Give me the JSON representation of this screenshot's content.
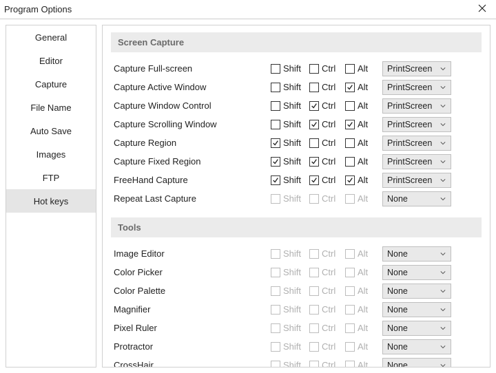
{
  "window": {
    "title": "Program Options"
  },
  "sidebar": {
    "items": [
      {
        "label": "General",
        "selected": false
      },
      {
        "label": "Editor",
        "selected": false
      },
      {
        "label": "Capture",
        "selected": false
      },
      {
        "label": "File Name",
        "selected": false
      },
      {
        "label": "Auto Save",
        "selected": false
      },
      {
        "label": "Images",
        "selected": false
      },
      {
        "label": "FTP",
        "selected": false
      },
      {
        "label": "Hot keys",
        "selected": true
      }
    ]
  },
  "labels": {
    "shift": "Shift",
    "ctrl": "Ctrl",
    "alt": "Alt"
  },
  "sections": [
    {
      "title": "Screen Capture",
      "rows": [
        {
          "label": "Capture Full-screen",
          "shift": false,
          "ctrl": false,
          "alt": false,
          "key": "PrintScreen",
          "enabled": true
        },
        {
          "label": "Capture Active Window",
          "shift": false,
          "ctrl": false,
          "alt": true,
          "key": "PrintScreen",
          "enabled": true
        },
        {
          "label": "Capture Window Control",
          "shift": false,
          "ctrl": true,
          "alt": false,
          "key": "PrintScreen",
          "enabled": true
        },
        {
          "label": "Capture Scrolling Window",
          "shift": false,
          "ctrl": true,
          "alt": true,
          "key": "PrintScreen",
          "enabled": true
        },
        {
          "label": "Capture Region",
          "shift": true,
          "ctrl": false,
          "alt": false,
          "key": "PrintScreen",
          "enabled": true
        },
        {
          "label": "Capture Fixed Region",
          "shift": true,
          "ctrl": true,
          "alt": false,
          "key": "PrintScreen",
          "enabled": true
        },
        {
          "label": "FreeHand Capture",
          "shift": true,
          "ctrl": true,
          "alt": true,
          "key": "PrintScreen",
          "enabled": true
        },
        {
          "label": "Repeat Last Capture",
          "shift": false,
          "ctrl": false,
          "alt": false,
          "key": "None",
          "enabled": false
        }
      ]
    },
    {
      "title": "Tools",
      "rows": [
        {
          "label": "Image Editor",
          "shift": false,
          "ctrl": false,
          "alt": false,
          "key": "None",
          "enabled": false
        },
        {
          "label": "Color Picker",
          "shift": false,
          "ctrl": false,
          "alt": false,
          "key": "None",
          "enabled": false
        },
        {
          "label": "Color Palette",
          "shift": false,
          "ctrl": false,
          "alt": false,
          "key": "None",
          "enabled": false
        },
        {
          "label": "Magnifier",
          "shift": false,
          "ctrl": false,
          "alt": false,
          "key": "None",
          "enabled": false
        },
        {
          "label": "Pixel Ruler",
          "shift": false,
          "ctrl": false,
          "alt": false,
          "key": "None",
          "enabled": false
        },
        {
          "label": "Protractor",
          "shift": false,
          "ctrl": false,
          "alt": false,
          "key": "None",
          "enabled": false
        },
        {
          "label": "CrossHair",
          "shift": false,
          "ctrl": false,
          "alt": false,
          "key": "None",
          "enabled": false
        }
      ]
    }
  ]
}
